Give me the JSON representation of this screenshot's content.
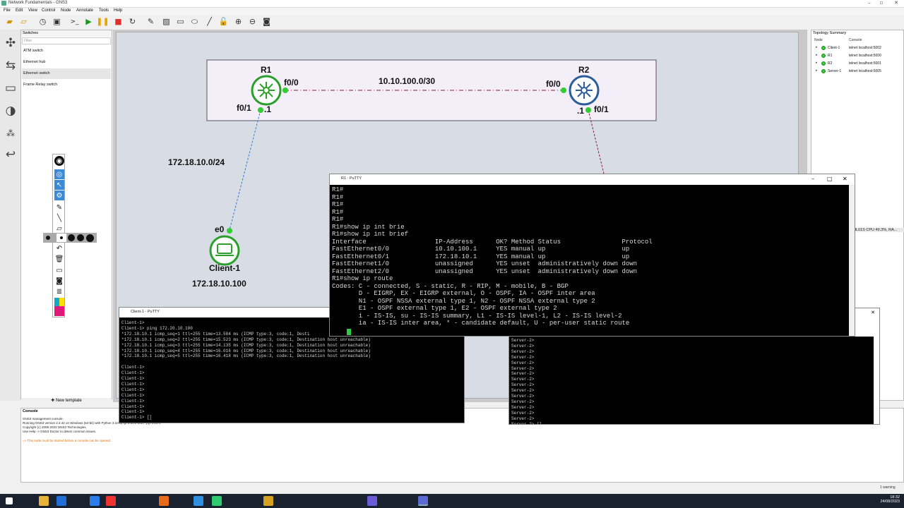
{
  "window": {
    "title": "Network Fundamentals - GNS3"
  },
  "menu": [
    "File",
    "Edit",
    "View",
    "Control",
    "Node",
    "Annotate",
    "Tools",
    "Help"
  ],
  "switches_panel": {
    "title": "Switches",
    "filter_placeholder": "Filter",
    "items": [
      "ATM switch",
      "Ethernet hub",
      "Ethernet switch",
      "Frame Relay switch"
    ],
    "new_template": "New template"
  },
  "topology_summary": {
    "title": "Topology Summary",
    "columns": [
      "Node",
      "Console"
    ],
    "rows": [
      {
        "node": "Client-1",
        "console": "telnet localhost:5002"
      },
      {
        "node": "R1",
        "console": "telnet localhost:5000"
      },
      {
        "node": "R2",
        "console": "telnet localhost:5001"
      },
      {
        "node": "Server-1",
        "console": "telnet localhost:5005"
      }
    ]
  },
  "canvas": {
    "r1_label": "R1",
    "r2_label": "R2",
    "r1_f00": "f0/0",
    "r2_f00": "f0/0",
    "r1_f01": "f0/1",
    "r2_f01": "f0/1",
    "r1_dot1": ".1",
    "r2_dot1": ".1",
    "link_subnet": "10.10.100.0/30",
    "lan_subnet": "172.18.10.0/24",
    "client_iface": "e0",
    "client_label": "Client-1",
    "client_ip": "172.18.10.100",
    "status_right": "HL01S CPU 49.3%, RA..."
  },
  "r1_putty": {
    "title": "R1 - PuTTY",
    "lines": [
      "R1#",
      "R1#",
      "R1#",
      "R1#",
      "R1#",
      "R1#show ip int brie",
      "R1#show ip int brief",
      "Interface                  IP-Address      OK? Method Status                Protocol",
      "FastEthernet0/0            10.10.100.1     YES manual up                    up",
      "FastEthernet0/1            172.18.10.1     YES manual up                    up",
      "FastEthernet1/0            unassigned      YES unset  administratively down down",
      "FastEthernet2/0            unassigned      YES unset  administratively down down",
      "R1#show ip route",
      "Codes: C - connected, S - static, R - RIP, M - mobile, B - BGP",
      "       D - EIGRP, EX - EIGRP external, O - OSPF, IA - OSPF inter area",
      "       N1 - OSPF NSSA external type 1, N2 - OSPF NSSA external type 2",
      "       E1 - OSPF external type 1, E2 - OSPF external type 2",
      "       i - IS-IS, su - IS-IS summary, L1 - IS-IS level-1, L2 - IS-IS level-2",
      "       ia - IS-IS inter area, * - candidate default, U - per-user static route"
    ]
  },
  "client_putty": {
    "title": "Client-1 - PuTTY",
    "lines": [
      "Client-1>",
      "Client-1> ping 172.20.10.100",
      "*172.18.10.1 icmp_seq=1 ttl=255 time=13.584 ms (ICMP type:3, code:1, Desti",
      "*172.18.10.1 icmp_seq=2 ttl=255 time=15.523 ms (ICMP type:3, code:1, Destination host unreachable)",
      "*172.18.10.1 icmp_seq=3 ttl=255 time=14.135 ms (ICMP type:3, code:1, Destination host unreachable)",
      "*172.18.10.1 icmp_seq=4 ttl=255 time=16.016 ms (ICMP type:3, code:1, Destination host unreachable)",
      "*172.18.10.1 icmp_seq=5 ttl=255 time=16.418 ms (ICMP type:3, code:1, Destination host unreachable)",
      "",
      "Client-1>",
      "Client-1>",
      "Client-1>",
      "Client-1>",
      "Client-1>",
      "Client-1>",
      "Client-1>",
      "Client-1>",
      "Client-1>",
      "Client-1> []"
    ]
  },
  "server_putty": {
    "lines": [
      "Server-2>",
      "Server-2>",
      "Server-2>",
      "Server-2>",
      "Server-2>",
      "Server-2>",
      "Server-2>",
      "Server-2>",
      "Server-2>",
      "Server-2>",
      "Server-2>",
      "Server-2>",
      "Server-2>",
      "Server-2>",
      "Server-2>",
      "Server-2> []"
    ]
  },
  "console": {
    "title": "Console",
    "lines": [
      "GNS3 management console.",
      "Running GNS3 version 2.2.42 on Windows (64-bit) with Python 3.10.11 Qt 5.15.2 and PyQt 5.15.9.",
      "Copyright (c) 2006-2023 GNS3 Technologies.",
      "Use Help -> GNS3 Doctor to detect common issues.",
      "",
      "=> This node must be started before a console can be opened."
    ]
  },
  "taskbar": {
    "warning": "1 warning",
    "time": "18:32",
    "date": "24/08/2023"
  },
  "colors": {
    "link_red": "#8a1a4a",
    "link_blue": "#3a7bd5",
    "router_green": "#2aa02a",
    "router_blue": "#2a5d9a",
    "led_green": "#33cc33"
  }
}
